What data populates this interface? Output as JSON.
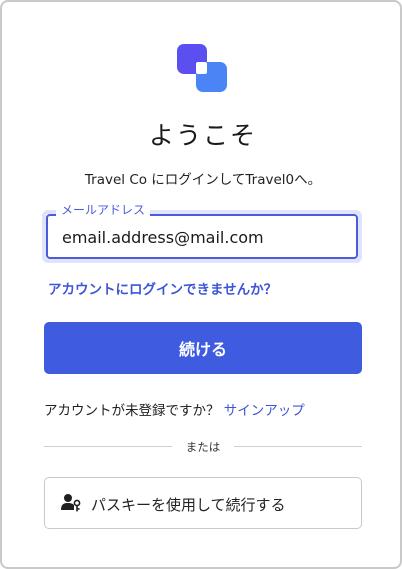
{
  "colors": {
    "accent": "#3f5be0",
    "link": "#3d54d6",
    "logo_primary": "#5b4ff0",
    "logo_secondary": "#4a84f5"
  },
  "header": {
    "logo_icon": "brand-logo-icon",
    "title": "ようこそ",
    "subtitle": "Travel Co にログインしてTravel0へ。"
  },
  "form": {
    "email_label": "メールアドレス",
    "email_value": "email.address@mail.com",
    "forgot_link": "アカウントにログインできませんか？",
    "continue_label": "続ける"
  },
  "signup": {
    "prompt": "アカウントが未登録ですか？",
    "link": "サインアップ"
  },
  "divider": {
    "text": "または"
  },
  "passkey": {
    "icon": "passkey-user-key-icon",
    "label": "パスキーを使用して続行する"
  }
}
